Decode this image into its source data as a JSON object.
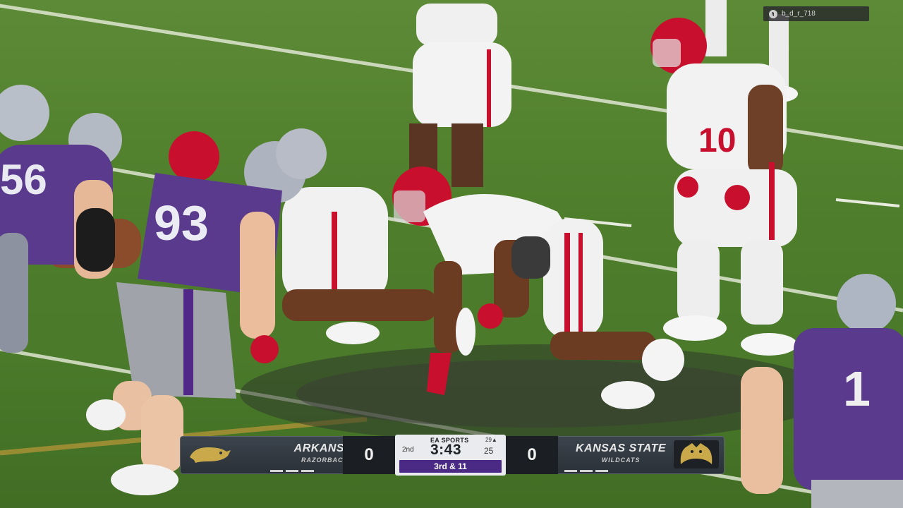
{
  "gamertag": {
    "icon": "playstation-icon",
    "name": "b_d_r_718"
  },
  "scoreboard": {
    "away": {
      "team": "ARKANSAS",
      "mascot": "RAZORBACKS",
      "score": "0",
      "logo": "razorback-logo",
      "color": "#9d2235"
    },
    "home": {
      "team": "KANSAS STATE",
      "mascot": "WILDCATS",
      "score": "0",
      "logo": "wildcat-logo",
      "color": "#512888"
    },
    "center": {
      "brand": "EA SPORTS",
      "quarter": "2nd",
      "clock": "3:43",
      "play_label": "29▲",
      "play_clock": "25",
      "down_distance": "3rd & 11"
    }
  },
  "players": {
    "home_numbers": [
      "56",
      "93",
      "1"
    ],
    "away_numbers": [
      "10"
    ]
  },
  "colors": {
    "field_green": "#4f7f2c",
    "ksu_purple": "#512888",
    "ark_red": "#c8102e"
  }
}
